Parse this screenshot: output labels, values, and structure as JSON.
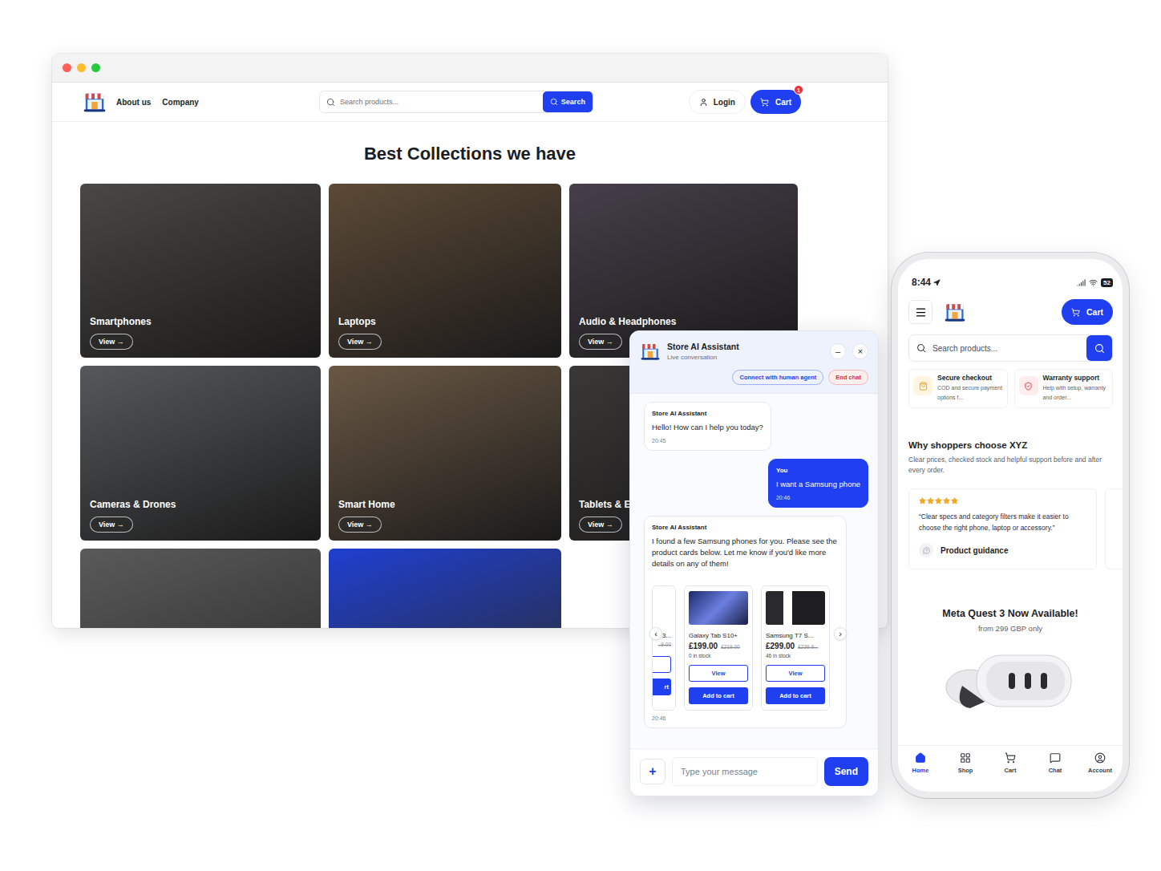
{
  "browser": {
    "nav": [
      "About us",
      "Company"
    ],
    "search": {
      "placeholder": "Search products...",
      "button": "Search"
    },
    "login": "Login",
    "cart": {
      "label": "Cart",
      "badge": "1"
    },
    "heading": "Best Collections we have",
    "collections": [
      {
        "name": "Smartphones",
        "button": "View →",
        "color": "#4a4744"
      },
      {
        "name": "Laptops",
        "button": "View →",
        "color": "#5c4a36"
      },
      {
        "name": "Audio & Headphones",
        "button": "View →",
        "color": "#463f4a"
      },
      {
        "name": "Cameras & Drones",
        "button": "View →",
        "color": "#55595c"
      },
      {
        "name": "Smart Home",
        "button": "View →",
        "color": "#6a5844"
      },
      {
        "name": "Tablets & E-",
        "button": "View →",
        "color": "#3a3836"
      }
    ],
    "more_collections": [
      {
        "color": "#5a5a5a"
      },
      {
        "color": "#1f3fd0"
      }
    ]
  },
  "chat": {
    "title": "Store AI Assistant",
    "subtitle": "Live conversation",
    "minimize": "–",
    "close": "×",
    "actions": [
      {
        "label": "Connect with human agent",
        "kind": "agent"
      },
      {
        "label": "End chat",
        "kind": "end"
      }
    ],
    "messages": [
      {
        "kind": "bot",
        "author": "Store AI Assistant",
        "text": "Hello! How can I help you today?",
        "time": "20:45"
      },
      {
        "kind": "user",
        "author": "You",
        "text": "I want a Samsung phone",
        "time": "20:46"
      },
      {
        "kind": "products",
        "author": "Store AI Assistant",
        "text": "I found a few Samsung phones for you. Please see the product cards below. Let me know if you'd like more details on any of them!",
        "time": "20:46"
      }
    ],
    "products": [
      {
        "kind": "partial",
        "name": "3...",
        "price": "",
        "old_price": "..9.00",
        "stock": "",
        "view": "",
        "add": "rt"
      },
      {
        "kind": "full",
        "name": "Galaxy Tab S10+",
        "price": "£199.00",
        "old_price": "£219.00",
        "stock": "0 in stock",
        "view": "View",
        "add": "Add to cart"
      },
      {
        "kind": "full",
        "name": "Samsung T7 S...",
        "price": "£299.00",
        "old_price": "£239.9...",
        "stock": "46 in stock",
        "view": "View",
        "add": "Add to cart"
      }
    ],
    "prev": "‹",
    "next": "›",
    "attach": "+",
    "input_placeholder": "Type your message",
    "send": "Send"
  },
  "phone": {
    "time": "8:44",
    "battery": "52",
    "cart": "Cart",
    "search_placeholder": "Search products...",
    "features": [
      {
        "title": "Secure checkout",
        "text": "COD and secure payment options f..."
      },
      {
        "title": "Warranty support",
        "text": "Help with setup, warranty and order..."
      }
    ],
    "section_title": "Why shoppers choose XYZ",
    "section_text": "Clear prices, checked stock and helpful support before and after every order.",
    "reviews": [
      {
        "kind": "full",
        "stars": 5,
        "text": "“Clear specs and category filters make it easier to choose the right phone, laptop or accessory.”",
        "tag": "Product guidance"
      },
      {
        "kind": "partial",
        "stars": 1,
        "text": "",
        "tag": ""
      }
    ],
    "promo": {
      "title": "Meta Quest 3 Now Available!",
      "subtitle": "from 299 GBP only"
    },
    "nav": [
      {
        "label": "Home",
        "selected": true
      },
      {
        "label": "Shop",
        "selected": false
      },
      {
        "label": "Cart",
        "selected": false
      },
      {
        "label": "Chat",
        "selected": false
      },
      {
        "label": "Account",
        "selected": false
      }
    ]
  }
}
